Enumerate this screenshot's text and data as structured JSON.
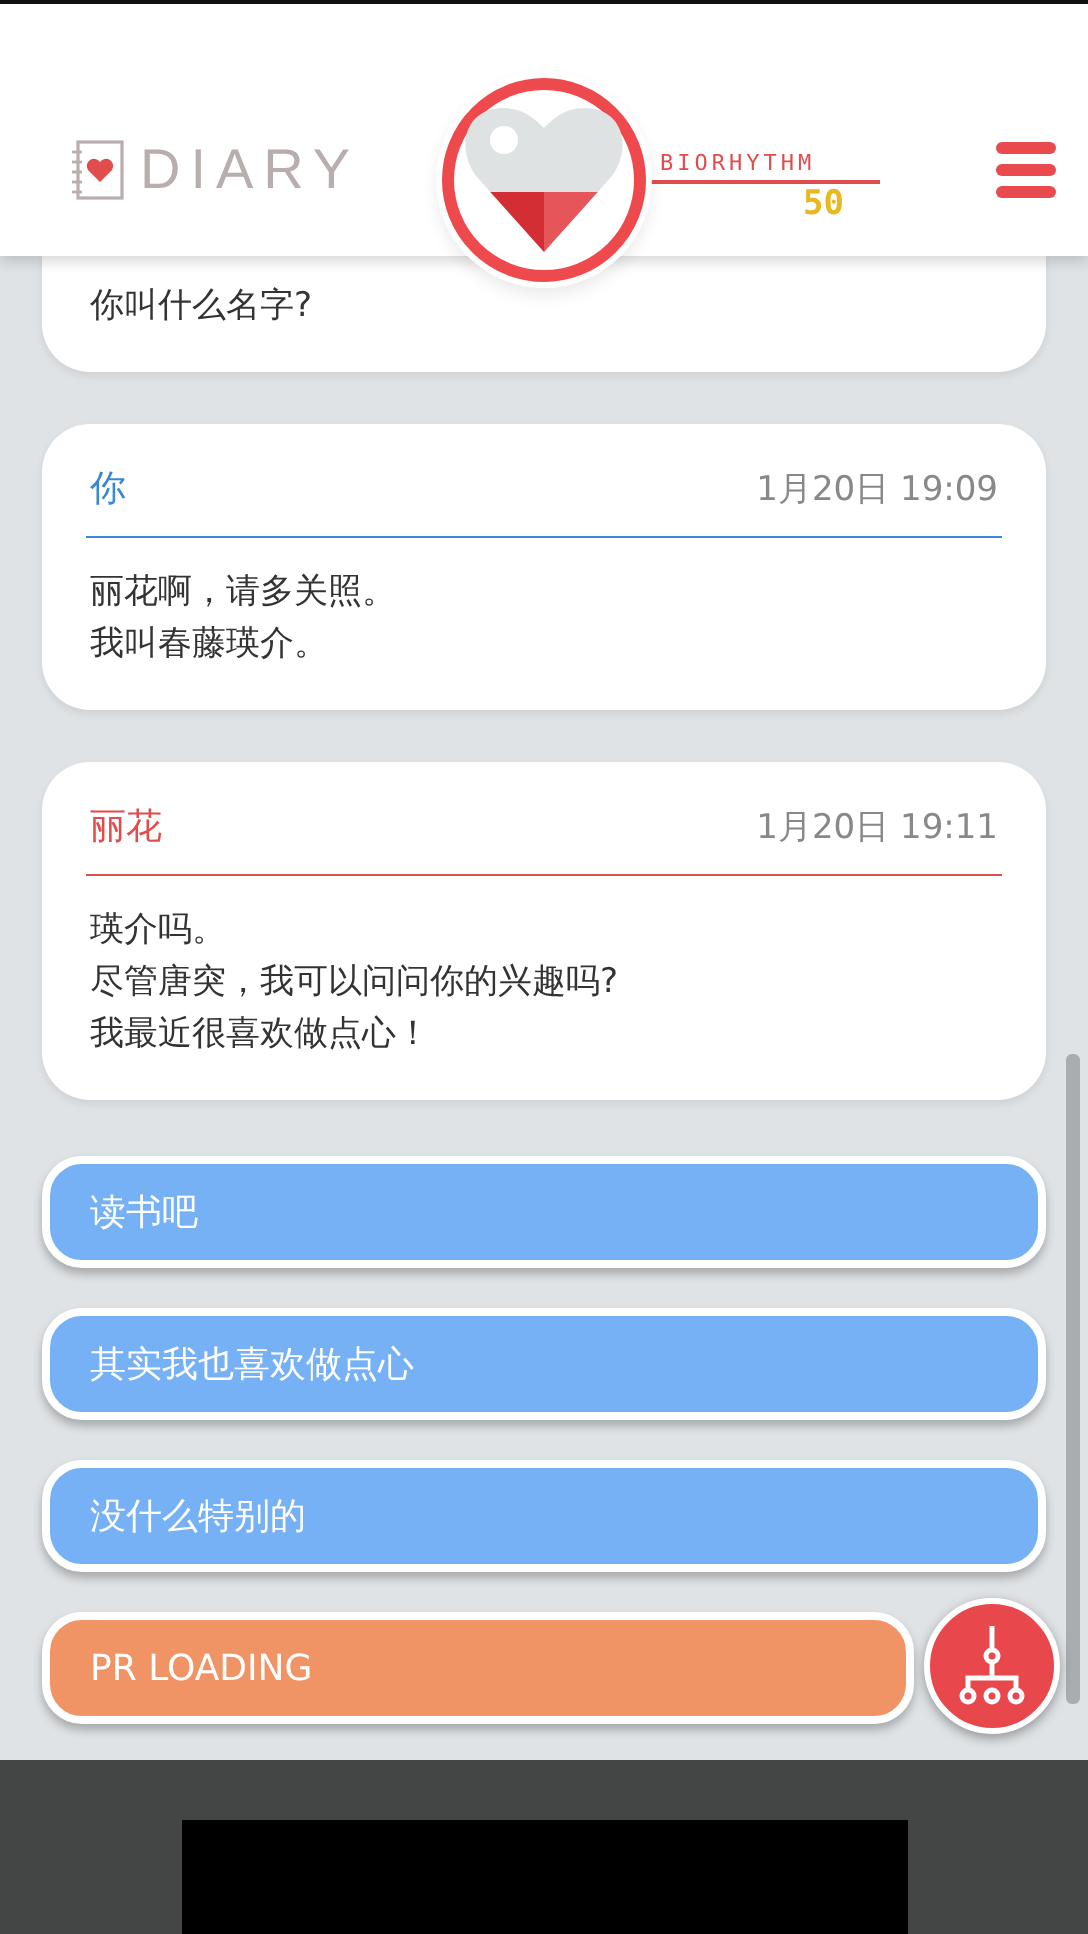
{
  "header": {
    "logo": "DIARY",
    "biorhythm": {
      "label": "BIORHYTHM",
      "value": "50"
    }
  },
  "messages": [
    {
      "partial": true,
      "lines": [
        "你叫什么名字?"
      ]
    },
    {
      "partial": false,
      "name": "你",
      "color": "#3a86d8",
      "time": "1月20日 19:09",
      "lines": [
        "丽花啊，请多关照。",
        "我叫春藤瑛介。"
      ]
    },
    {
      "partial": false,
      "name": "丽花",
      "color": "#e14c4c",
      "time": "1月20日 19:11",
      "lines": [
        "瑛介吗。",
        "尽管唐突，我可以问问你的兴趣吗?",
        "我最近很喜欢做点心！"
      ]
    }
  ],
  "options": [
    {
      "kind": "choice",
      "label": "读书吧"
    },
    {
      "kind": "choice",
      "label": "其实我也喜欢做点心"
    },
    {
      "kind": "choice",
      "label": "没什么特别的"
    },
    {
      "kind": "loading",
      "label": "PR LOADING"
    }
  ]
}
